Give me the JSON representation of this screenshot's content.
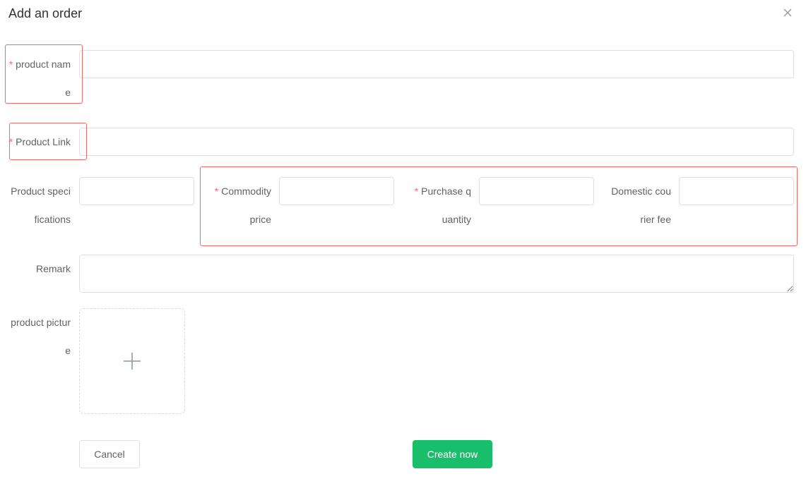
{
  "dialog": {
    "title": "Add an order"
  },
  "form": {
    "required_mark": "*",
    "product_name": {
      "label": "product name",
      "value": "",
      "required": true
    },
    "product_link": {
      "label": "Product Link",
      "value": "",
      "required": true
    },
    "product_specifications": {
      "label": "Product specifications",
      "value": "",
      "required": false
    },
    "commodity_price": {
      "label": "Commodity price",
      "value": "",
      "required": true
    },
    "purchase_quantity": {
      "label": "Purchase quantity",
      "value": "",
      "required": true
    },
    "domestic_courier_fee": {
      "label": "Domestic courier fee",
      "value": "",
      "required": false
    },
    "remark": {
      "label": "Remark",
      "value": ""
    },
    "product_picture": {
      "label": "product picture"
    }
  },
  "footer": {
    "cancel_label": "Cancel",
    "create_label": "Create now"
  },
  "colors": {
    "required": "#f56c6c",
    "primary_button": "#19be6b",
    "highlight_box": "#ee6b66",
    "border": "#dcdfe6"
  },
  "icons": {
    "close": "close-icon",
    "upload": "plus-icon"
  }
}
